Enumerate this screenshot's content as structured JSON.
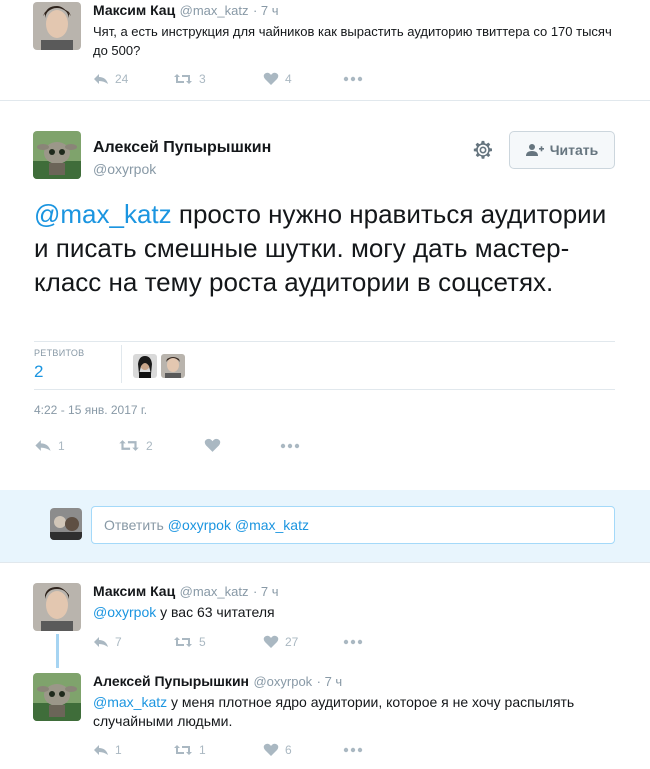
{
  "tweet1": {
    "author": "Максим Кац",
    "handle": "@max_katz",
    "time": "· 7 ч",
    "text": "Чят, а есть инструкция для чайников как вырастить аудиторию твиттера со 170 тысяч до 500?",
    "replies": "24",
    "retweets": "3",
    "likes": "4"
  },
  "main": {
    "author": "Алексей Пупырышкин",
    "handle": "@oxyrpok",
    "follow_label": "Читать",
    "mention": "@max_katz",
    "text": " просто нужно нравиться аудитории и писать смешные шутки. могу дать мастер-класс на тему роста аудитории в соцсетях.",
    "stats_label": "РЕТВИТОВ",
    "stats_count": "2",
    "timestamp": "4:22 - 15 янв. 2017 г.",
    "replies": "1",
    "retweets": "2"
  },
  "reply_box": {
    "placeholder_prefix": "Ответить ",
    "placeholder_mentions": "@oxyrpok @max_katz"
  },
  "reply1": {
    "author": "Максим Кац",
    "handle": "@max_katz",
    "time": "· 7 ч",
    "mention": "@oxyrpok",
    "text": " у вас 63 читателя",
    "replies": "7",
    "retweets": "5",
    "likes": "27"
  },
  "reply2": {
    "author": "Алексей Пупырышкин",
    "handle": "@oxyrpok",
    "time": "· 7 ч",
    "mention": "@max_katz",
    "text": " у меня плотное ядро аудитории, которое я не хочу распылять случайными людьми.",
    "replies": "1",
    "retweets": "1",
    "likes": "6"
  },
  "colors": {
    "accent": "#1b95e0",
    "muted": "#8899a6",
    "icon": "#aab8c2",
    "reply_bg": "#e8f5fd"
  }
}
